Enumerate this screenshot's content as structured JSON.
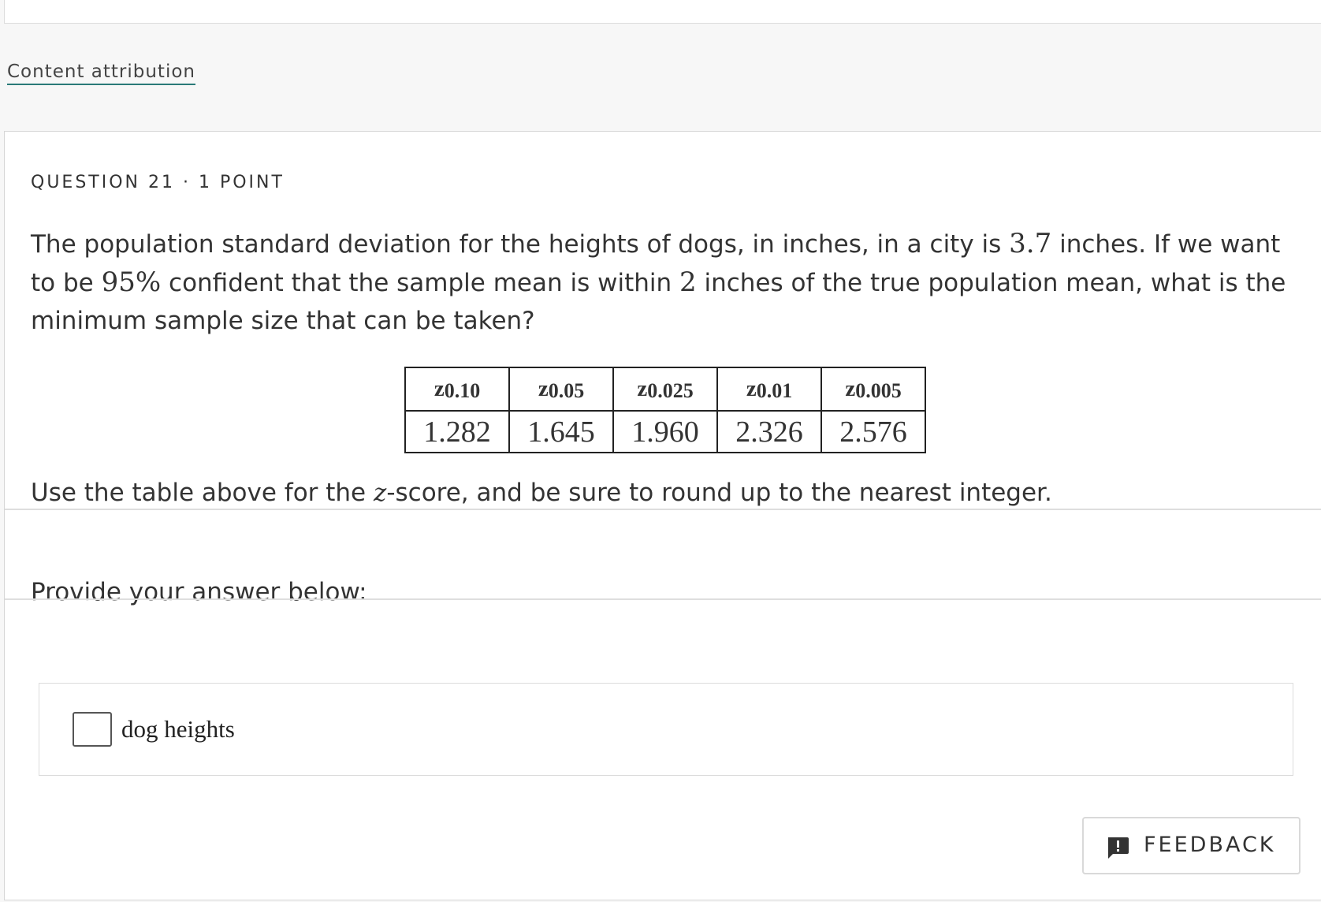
{
  "attribution": {
    "link_text": "Content attribution"
  },
  "question": {
    "number_label": "QUESTION 21",
    "separator": "·",
    "points_label": "1 POINT",
    "text_part1": "The population standard deviation for the heights of dogs, in inches, in a city is ",
    "sigma": "3.7",
    "text_part2": " inches. If we want to be ",
    "confidence": "95%",
    "text_part3": " confident that the sample mean is within ",
    "margin": "2",
    "text_part4": " inches of the true population mean, what is the minimum sample size that can be taken?"
  },
  "z_table": {
    "headers": [
      {
        "symbol": "z",
        "sub": "0.10"
      },
      {
        "symbol": "z",
        "sub": "0.05"
      },
      {
        "symbol": "z",
        "sub": "0.025"
      },
      {
        "symbol": "z",
        "sub": "0.01"
      },
      {
        "symbol": "z",
        "sub": "0.005"
      }
    ],
    "values": [
      "1.282",
      "1.645",
      "1.960",
      "2.326",
      "2.576"
    ]
  },
  "instruction": {
    "part1": "Use the table above for the ",
    "var": "z",
    "part2": "-score, and be sure to round up to the nearest integer."
  },
  "answer": {
    "prompt": "Provide your answer below:",
    "input_value": "",
    "suffix": "dog heights"
  },
  "feedback": {
    "label": "FEEDBACK",
    "icon": "feedback-icon"
  }
}
